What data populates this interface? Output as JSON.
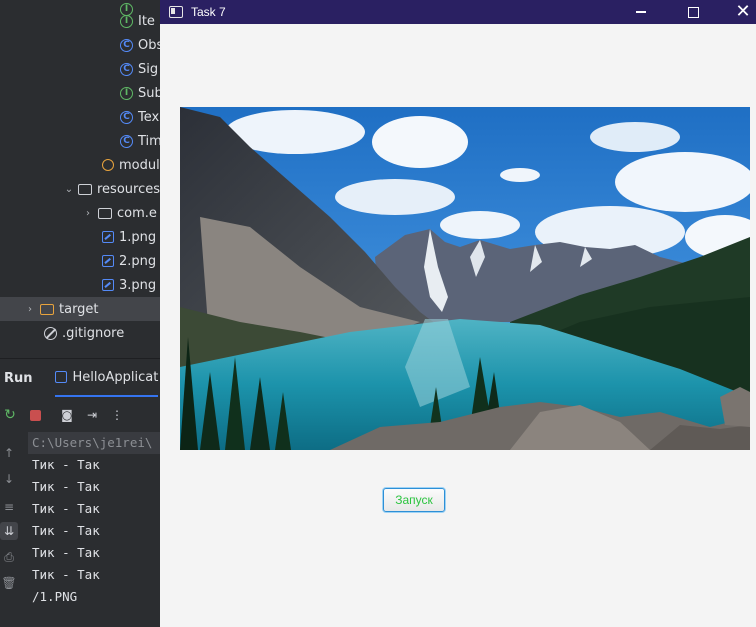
{
  "ide": {
    "project_tree": [
      {
        "label": "Ite",
        "icon": "interface-icon",
        "indent": 3
      },
      {
        "label": "Obs",
        "icon": "class-icon",
        "indent": 3
      },
      {
        "label": "Sig",
        "icon": "class-icon",
        "indent": 3
      },
      {
        "label": "Sub",
        "icon": "interface-icon",
        "indent": 3
      },
      {
        "label": "Tex",
        "icon": "class-icon",
        "indent": 3
      },
      {
        "label": "Tim",
        "icon": "class-icon",
        "indent": 3
      },
      {
        "label": "modul",
        "icon": "module-icon",
        "indent": 2
      },
      {
        "label": "resources",
        "icon": "folder-icon",
        "indent": 1
      },
      {
        "label": "com.e",
        "icon": "folder-icon",
        "indent": 2
      },
      {
        "label": "1.png",
        "icon": "image-icon",
        "indent": 2
      },
      {
        "label": "2.png",
        "icon": "image-icon",
        "indent": 2
      },
      {
        "label": "3.png",
        "icon": "image-icon",
        "indent": 2
      },
      {
        "label": "target",
        "icon": "folder-icon",
        "indent": 0
      },
      {
        "label": ".gitignore",
        "icon": "gitignore-icon",
        "indent": 0
      }
    ],
    "run_panel": {
      "title": "Run",
      "tab_label": "HelloApplicat"
    },
    "console": {
      "command_line": "C:\\Users\\je1rei\\",
      "lines": [
        "Тик - Так",
        "Тик - Так",
        "Тик - Так",
        "Тик - Так",
        "Тик - Так",
        "Тик - Так",
        "/1.PNG"
      ]
    }
  },
  "window": {
    "title": "Task 7",
    "image": {
      "description_icon": "mountain-lake-photo"
    },
    "launch_button": "Запуск",
    "accent_colors": {
      "titlebar": "#2a2062",
      "button_text": "#2cc440",
      "button_border": "#2d8fd6"
    }
  }
}
